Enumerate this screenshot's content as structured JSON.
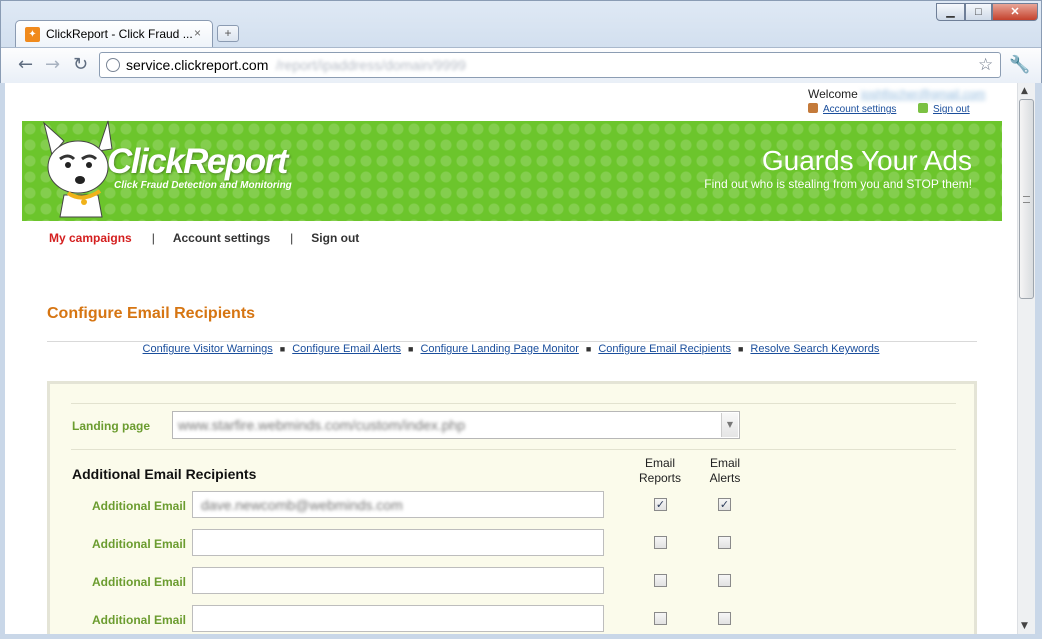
{
  "browser": {
    "tab_title": "ClickReport - Click Fraud ...",
    "tab_close": "×",
    "new_tab": "+",
    "url_host": "service.clickreport.com",
    "url_path": "/report/ipaddress/domain/9999",
    "window_min": "▁",
    "window_max": "□",
    "window_close": "✕"
  },
  "header": {
    "welcome_label": "Welcome",
    "user_email": "joshfischer@gmail.com",
    "account_settings": "Account settings",
    "sign_out": "Sign out"
  },
  "banner": {
    "brand": "ClickReport",
    "tagline": "Click Fraud Detection and Monitoring",
    "headline": "Guards Your Ads",
    "subhead": "Find out who is stealing from you and STOP them!",
    "brand_color": "#6cc52c"
  },
  "nav": {
    "items": [
      "My campaigns",
      "Account settings",
      "Sign out"
    ],
    "separator": "|",
    "active_color": "#d41f1f"
  },
  "section": {
    "title": "Configure Email Recipients",
    "title_color": "#d67512"
  },
  "sublinks": {
    "items": [
      "Configure Visitor Warnings",
      "Configure Email Alerts",
      "Configure Landing Page Monitor",
      "Configure Email Recipients",
      "Resolve Search Keywords"
    ],
    "bullet": "■"
  },
  "form": {
    "landing_label": "Landing page",
    "landing_value": "www.starfire.webminds.com/custom/index.php",
    "recipients_heading": "Additional Email Recipients",
    "col_reports": "Email Reports",
    "col_alerts": "Email Alerts",
    "label_color": "#6b9c2f",
    "rows": [
      {
        "label": "Additional Email",
        "value": "dave.newcomb@webminds.com",
        "reports": "✓",
        "alerts": "✓"
      },
      {
        "label": "Additional Email",
        "value": "",
        "reports": "",
        "alerts": ""
      },
      {
        "label": "Additional Email",
        "value": "",
        "reports": "",
        "alerts": ""
      },
      {
        "label": "Additional Email",
        "value": "",
        "reports": "",
        "alerts": ""
      }
    ]
  }
}
